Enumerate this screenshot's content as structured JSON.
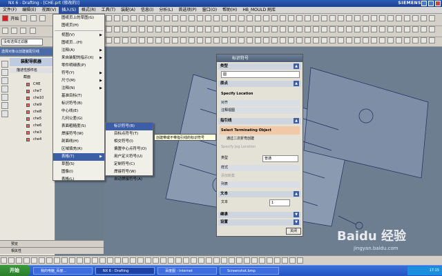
{
  "window": {
    "title": "NX 6 - Drafting - [CHE.prt (修改的)]",
    "brand": "SIEMENS"
  },
  "menubar": [
    "文件(F)",
    "编辑(E)",
    "视图(V)",
    "插入(S)",
    "格式(R)",
    "工具(T)",
    "装配(A)",
    "信息(I)",
    "分析(L)",
    "首选项(P)",
    "窗口(O)",
    "帮助(H)",
    "HB_MOULD 刷库"
  ],
  "menubar_active_index": 3,
  "toolbar": {
    "start_label": "开始",
    "filter_value": "没有选择过滤器",
    "selection_bar": "选择对象以创建装配引线"
  },
  "navigator": {
    "title": "装配导航器",
    "column_header": "描述性部件名",
    "root": "截面",
    "rows": [
      "CHE",
      "che7",
      "che10",
      "che9",
      "che8",
      "che5",
      "che6",
      "che3",
      "che4"
    ],
    "footer1": "预览",
    "footer2": "相关性"
  },
  "insert_menu": [
    "视图(V)",
    "图纸页...(H)",
    "注释(A)",
    "来自装配的指示(X)",
    "零件明细表(P)",
    "符号(Y)",
    "尺寸(M)",
    "注释(N)",
    "基准目标(T)",
    "标识符号(B)",
    "中心线(E)",
    "几何公差(G)",
    "表面粗糙度(S)",
    "焊接符号(W)",
    "剖面线(H)",
    "区域填充(R)",
    "表格(T)",
    "草图(S)",
    "图像(I)",
    "表格(L)"
  ],
  "insert_menu_top": [
    "图纸页上的草图(G)",
    "图纸页(H)"
  ],
  "insert_menu_selected_index": 16,
  "submenu": [
    "标识符号(B)",
    "目标点符号(T)",
    "相交符号(I)",
    "偏置中心点符号(O)",
    "用户定义符号(U)",
    "定制符号(C)",
    "焊接符号(W)",
    "自动焊接符号(A)"
  ],
  "submenu_selected_index": 0,
  "tooltip": "创建带或不带指引线的标识符号",
  "dialog": {
    "title": "标识符号",
    "sec_type": "类型",
    "type_value": "圆",
    "sec_origin": "原点",
    "specify_location": "Specify Location",
    "align": "对齐",
    "assoc": "注释视图",
    "sec_leader": "指引线",
    "select_terminating": "Select Terminating Object",
    "create_leader_check": "通过二次折弯创建",
    "specify_jog": "Specify Jog Location",
    "leader_type_label": "类型",
    "leader_type_value": "普通",
    "style": "样式",
    "leader_extra": "添加新集",
    "list": "列表",
    "sec_text": "文本",
    "text_label": "文本",
    "text_value": "1",
    "inherit": "继承",
    "settings": "设置",
    "close": "关闭"
  },
  "taskbar": {
    "start": "开始",
    "tasks": [
      "我的电脑_百度...",
      "NX 6 - Drafting",
      "百度图 - Internet",
      "Screenshot.bmp"
    ],
    "active_index": 1,
    "clock": "17:15"
  },
  "watermark": {
    "main": "Baidu 经验",
    "sub": "jingyan.baidu.com"
  },
  "colors": {
    "title": "#2a5cb8",
    "menu_sel": "#3b5ea6",
    "graphics_bg": "#6c7e90",
    "taskbar": "#2254c4"
  }
}
